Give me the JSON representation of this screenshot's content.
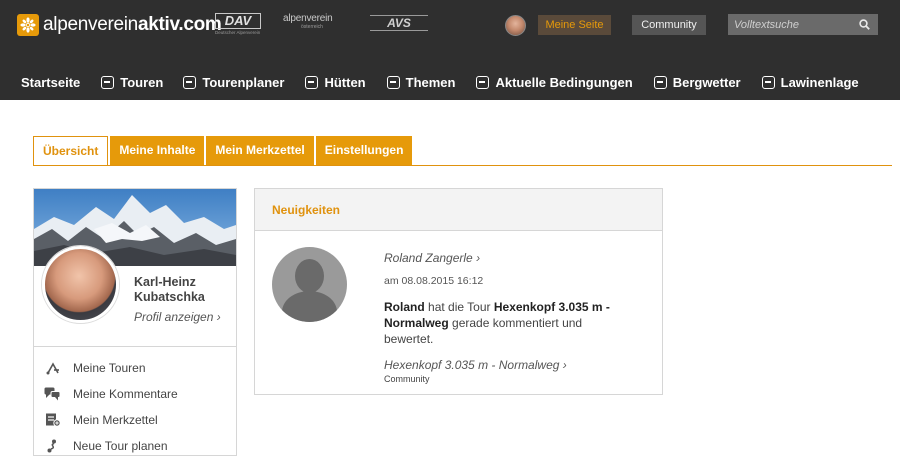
{
  "header": {
    "logo_text_light": "alpenverein",
    "logo_text_bold": "aktiv.com",
    "partners": {
      "dav_big": "DAV",
      "dav_small": "Deutscher Alpenverein",
      "oeav_big": "alpenverein",
      "oeav_small": "österreich",
      "avs_big": "AVS"
    },
    "meine_seite_label": "Meine Seite",
    "community_label": "Community",
    "search_placeholder": "Volltextsuche"
  },
  "nav": {
    "items": [
      {
        "label": "Startseite"
      },
      {
        "label": "Touren",
        "icon": "tour-icon"
      },
      {
        "label": "Tourenplaner",
        "icon": "planner-icon"
      },
      {
        "label": "Hütten",
        "icon": "hut-icon"
      },
      {
        "label": "Themen",
        "icon": "topics-icon"
      },
      {
        "label": "Aktuelle Bedingungen",
        "icon": "conditions-icon"
      },
      {
        "label": "Bergwetter",
        "icon": "weather-icon"
      },
      {
        "label": "Lawinenlage",
        "icon": "avalanche-icon"
      }
    ]
  },
  "tabs": [
    {
      "label": "Übersicht",
      "active": true
    },
    {
      "label": "Meine Inhalte",
      "active": false
    },
    {
      "label": "Mein Merkzettel",
      "active": false
    },
    {
      "label": "Einstellungen",
      "active": false
    }
  ],
  "profile": {
    "name_line1": "Karl-Heinz",
    "name_line2": "Kubatschka",
    "profile_link": "Profil anzeigen",
    "menu": [
      {
        "label": "Meine Touren",
        "icon": "tours-icon"
      },
      {
        "label": "Meine Kommentare",
        "icon": "comments-icon"
      },
      {
        "label": "Mein Merkzettel",
        "icon": "bookmark-list-icon"
      },
      {
        "label": "Neue Tour planen",
        "icon": "route-plan-icon"
      }
    ]
  },
  "news": {
    "title": "Neuigkeiten",
    "author": "Roland Zangerle",
    "date": "am 08.08.2015 16:12",
    "text_actor": "Roland",
    "text_mid": "hat die Tour",
    "text_tour": "Hexenkopf 3.035 m - Normalweg",
    "text_end": "gerade kommentiert und bewertet.",
    "tour_link": "Hexenkopf 3.035 m - Normalweg",
    "tag": "Community"
  },
  "colors": {
    "header_bg": "#2f2f2f",
    "accent": "#e69a0a",
    "panel_bg": "#f3f3f3"
  }
}
